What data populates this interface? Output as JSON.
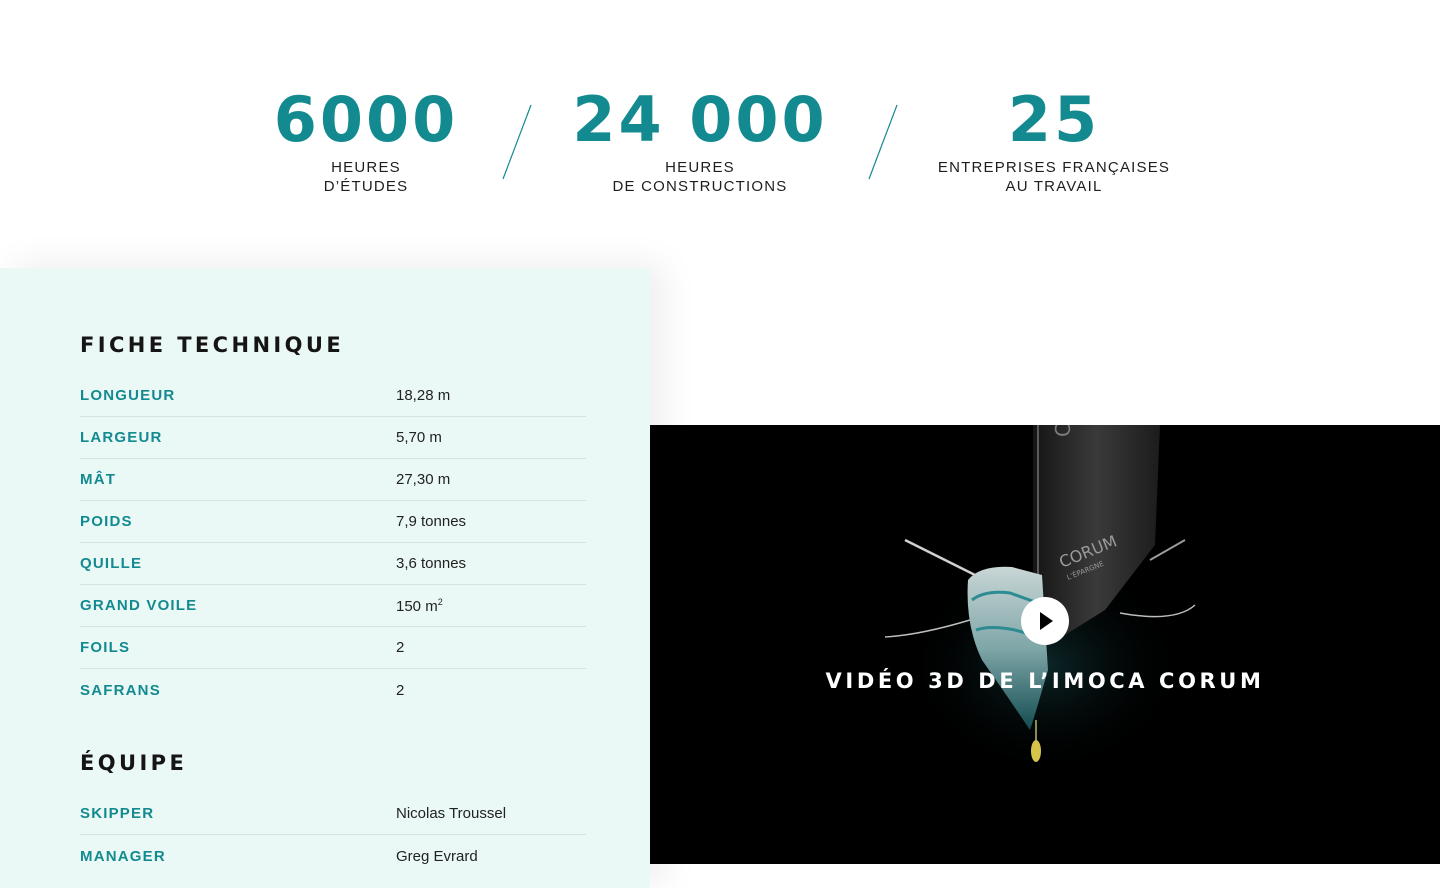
{
  "stats": [
    {
      "value": "6000",
      "label_line1": "HEURES",
      "label_line2": "D’ÉTUDES"
    },
    {
      "value": "24 000",
      "label_line1": "HEURES",
      "label_line2": "DE CONSTRUCTIONS"
    },
    {
      "value": "25",
      "label_line1": "ENTREPRISES FRANÇAISES",
      "label_line2": "AU TRAVAIL"
    }
  ],
  "technical": {
    "title": "FICHE TECHNIQUE",
    "rows": [
      {
        "key": "LONGUEUR",
        "value": "18,28 m"
      },
      {
        "key": "LARGEUR",
        "value": "5,70 m"
      },
      {
        "key": "MÂT",
        "value": "27,30 m"
      },
      {
        "key": "POIDS",
        "value": "7,9 tonnes"
      },
      {
        "key": "QUILLE",
        "value": "3,6 tonnes"
      },
      {
        "key": "GRAND VOILE",
        "value": "150 m",
        "value_sup": "2"
      },
      {
        "key": "FOILS",
        "value": "2"
      },
      {
        "key": "SAFRANS",
        "value": "2"
      }
    ]
  },
  "team": {
    "title": "ÉQUIPE",
    "rows": [
      {
        "key": "SKIPPER",
        "value": "Nicolas Troussel"
      },
      {
        "key": "MANAGER",
        "value": "Greg Evrard"
      }
    ]
  },
  "video": {
    "title": "VIDÉO 3D DE L’IMOCA CORUM",
    "sail_text": "CORUM",
    "sail_subtext": "L’ÉPARGNE"
  },
  "colors": {
    "accent": "#138a90",
    "card_bg": "#ebf9f6",
    "video_bg": "#000000"
  },
  "icons": {
    "divider": "slash-divider-icon",
    "play": "play-icon"
  }
}
